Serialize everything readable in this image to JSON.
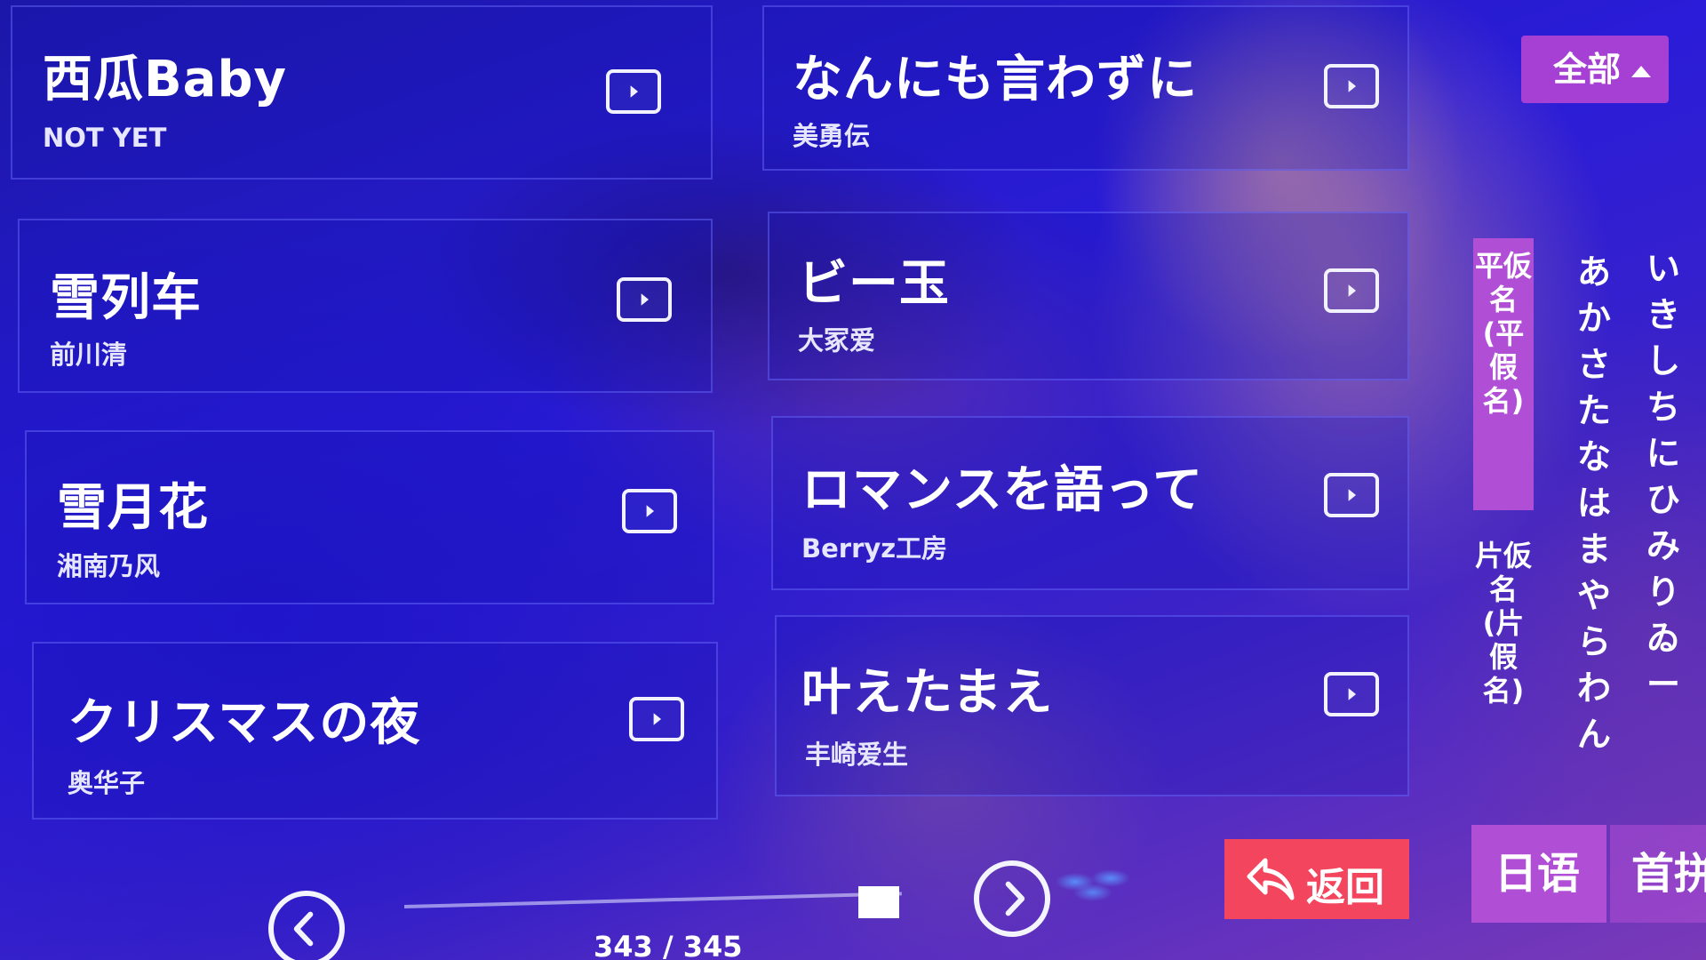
{
  "songs": [
    {
      "title": "西瓜Baby",
      "artist": "NOT YET"
    },
    {
      "title": "なんにも言わずに",
      "artist": "美勇伝"
    },
    {
      "title": "雪列车",
      "artist": "前川清"
    },
    {
      "title": "ビー玉",
      "artist": "大冢爱"
    },
    {
      "title": "雪月花",
      "artist": "湘南乃风"
    },
    {
      "title": "ロマンスを語って",
      "artist": "Berryz工房"
    },
    {
      "title": "クリスマスの夜",
      "artist": "奥华子"
    },
    {
      "title": "叶えたまえ",
      "artist": "丰崎爱生"
    }
  ],
  "filter": {
    "label": "全部",
    "icon": "caret-up-icon"
  },
  "kana_tabs": {
    "hiragana": "平仮名(平假名)",
    "katakana": "片仮名(片假名)",
    "active": "hiragana"
  },
  "kana_columns": [
    "あかさたなはまやらわん",
    "いきしちにひみりゐー"
  ],
  "pagination": {
    "counter": "343 / 345",
    "current": 343,
    "total": 345
  },
  "back_button": {
    "label": "返回",
    "icon": "back-arrow-icon"
  },
  "language_tabs": {
    "active": "日语",
    "next": "首拼"
  },
  "colors": {
    "accent_purple": "#b04fd6",
    "back_red": "#f4455e",
    "background_blue": "#2a1cd8"
  },
  "icons": {
    "play": "play-video-icon",
    "prev": "chevron-left-icon",
    "next": "chevron-right-icon"
  }
}
